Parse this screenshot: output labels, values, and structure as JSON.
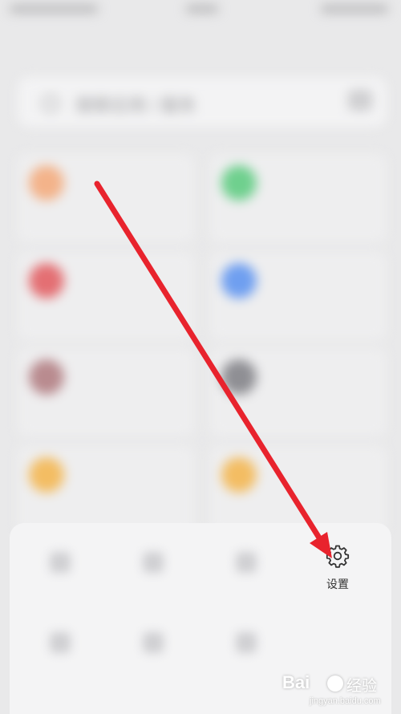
{
  "search": {
    "placeholder_text": "搜索应用 / 服务"
  },
  "apps": [
    {
      "title": "",
      "subtitle": "",
      "color": "#f3b38a"
    },
    {
      "title": "",
      "subtitle": "",
      "color": "#6fd08e"
    },
    {
      "title": "",
      "subtitle": "",
      "color": "#e46f73"
    },
    {
      "title": "",
      "subtitle": "",
      "color": "#6f9ff0"
    },
    {
      "title": "",
      "subtitle": "",
      "color": "#b98b8f"
    },
    {
      "title": "",
      "subtitle": "",
      "color": "#8f8f94"
    },
    {
      "title": "",
      "subtitle": "",
      "color": "#f3bd63"
    },
    {
      "title": "",
      "subtitle": "",
      "color": "#f3bd63"
    }
  ],
  "sheet": {
    "settings_label": "设置",
    "settings_icon": "gear-icon"
  },
  "annotation": {
    "arrow_color": "#e8232d"
  },
  "watermark": {
    "brand": "Bai",
    "product": "经验",
    "url": "jingyan.baidu.com"
  }
}
